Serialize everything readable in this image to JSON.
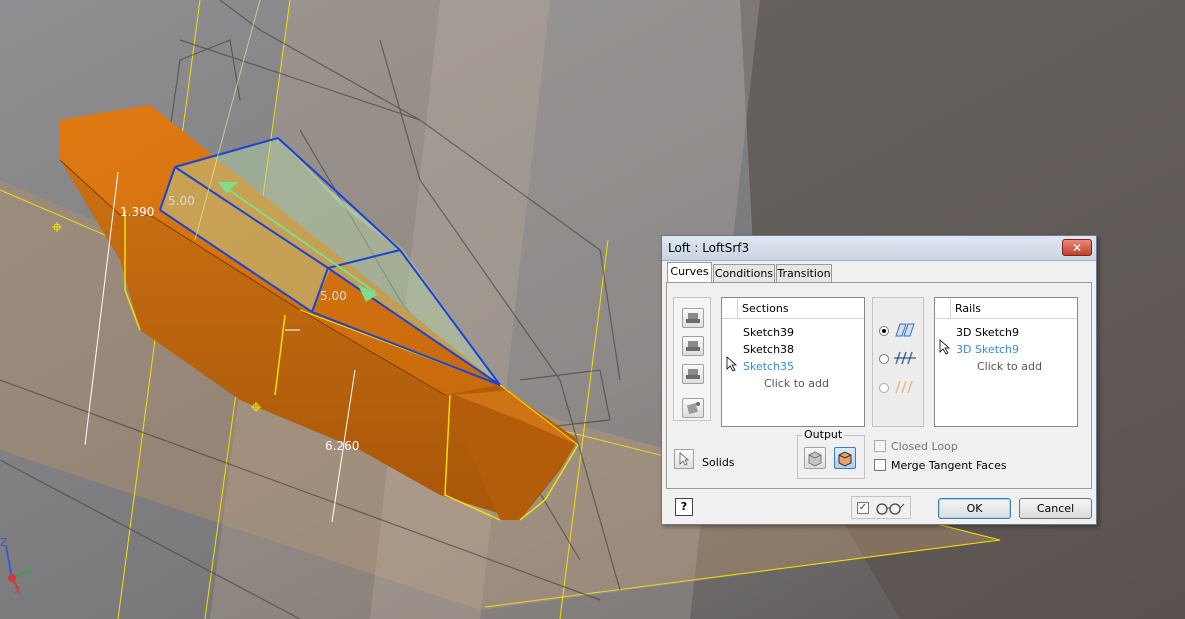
{
  "viewport": {
    "dimensions": [
      {
        "label": "1.390"
      },
      {
        "label": "5.00"
      },
      {
        "label": "5.00"
      },
      {
        "label": "6.260"
      }
    ],
    "triad_axes": [
      "Z",
      "Y",
      "X"
    ]
  },
  "dialog": {
    "title": "Loft : LoftSrf3",
    "close_glyph": "✕",
    "tabs": [
      "Curves",
      "Conditions",
      "Transition"
    ],
    "sections": {
      "header": "Sections",
      "items": [
        "Sketch39",
        "Sketch38",
        "Sketch35"
      ],
      "add_text": "Click to add"
    },
    "rails": {
      "header": "Rails",
      "items": [
        "3D Sketch9",
        "3D Sketch9"
      ],
      "add_text": "Click to add"
    },
    "solids_label": "Solids",
    "output": {
      "legend": "Output"
    },
    "closed_loop_label": "Closed Loop",
    "merge_tangent_label": "Merge Tangent Faces",
    "help_label": "?",
    "ok_label": "OK",
    "cancel_label": "Cancel",
    "preview_checked": "✓"
  },
  "colors": {
    "hull_orange": "#c86a10",
    "selection_blue": "#1a44d6",
    "sketch_yellow": "#f3e000",
    "dialog_bg": "#f0f0f0",
    "highlight_text": "#3a8ad8"
  }
}
